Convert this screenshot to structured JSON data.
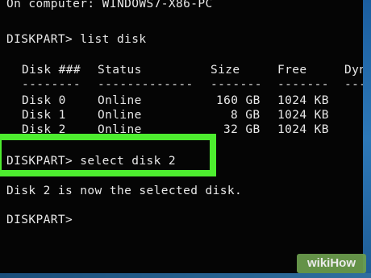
{
  "console": {
    "computer_line": "On computer: WINDOWS7-X86-PC",
    "prompt_list": "DISKPART> list disk",
    "table": {
      "headers": [
        "Disk ###",
        "Status",
        "Size",
        "Free",
        "Dyn"
      ],
      "separators": [
        "--------",
        "-------------",
        "-------",
        "-------",
        "---"
      ],
      "rows": [
        {
          "disk": "Disk 0",
          "status": "Online",
          "size": "160 GB",
          "free": "1024 KB"
        },
        {
          "disk": "Disk 1",
          "status": "Online",
          "size": "8 GB",
          "free": "1024 KB"
        },
        {
          "disk": "Disk 2",
          "status": "Online",
          "size": "32 GB",
          "free": "1024 KB"
        }
      ]
    },
    "prompt_select": "DISKPART> select disk 2",
    "result": "Disk 2 is now the selected disk.",
    "prompt_empty": "DISKPART>"
  },
  "watermark": "wikiHow",
  "colors": {
    "background": "#050505",
    "text": "#e8e8e8",
    "highlight": "#4ded2f"
  }
}
